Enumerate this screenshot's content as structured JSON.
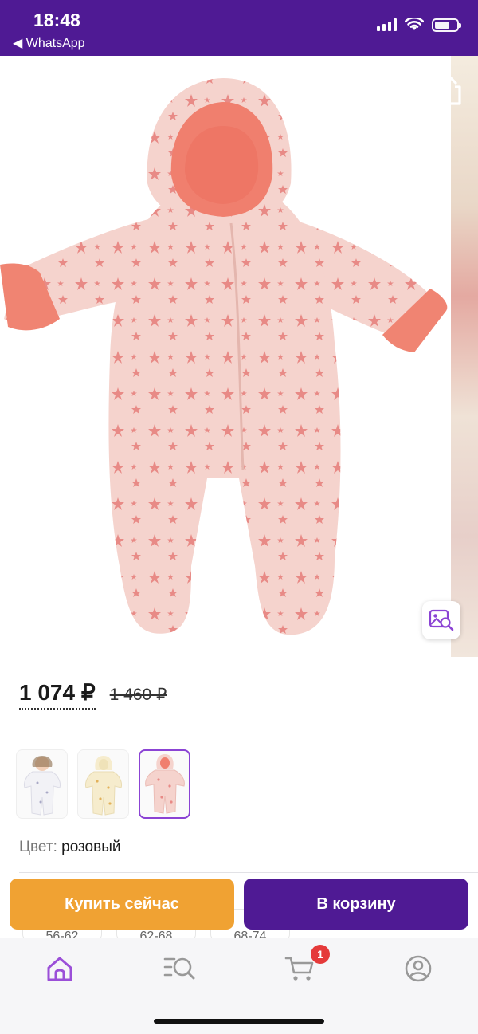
{
  "status_bar": {
    "time": "18:48",
    "back_app": "◀ WhatsApp"
  },
  "gallery": {
    "back_icon": "chevron-left-icon",
    "favorite_icon": "heart-outline-icon",
    "share_icon": "share-icon",
    "visual_search_icon": "image-search-icon",
    "product_image": "pink-star-print-baby-snowsuit"
  },
  "product": {
    "price": "1 074 ₽",
    "old_price": "1 460 ₽",
    "variants": [
      {
        "image": "white-snowsuit-with-baby",
        "selected": false
      },
      {
        "image": "cream-star-snowsuit",
        "selected": false
      },
      {
        "image": "pink-star-snowsuit",
        "selected": true
      }
    ],
    "color_label": "Цвет:",
    "color_value": "розовый",
    "sizes": [
      {
        "label": "56-62",
        "top": ""
      },
      {
        "label": "62-68",
        "top": ""
      },
      {
        "label": "68-74",
        "top": "7"
      }
    ]
  },
  "actions": {
    "buy_now": "Купить сейчас",
    "add_to_cart": "В корзину"
  },
  "tabbar": {
    "items": [
      {
        "name": "home",
        "icon": "home-icon",
        "active": true
      },
      {
        "name": "catalog",
        "icon": "catalog-search-icon",
        "active": false
      },
      {
        "name": "cart",
        "icon": "cart-icon",
        "active": false
      },
      {
        "name": "profile",
        "icon": "profile-icon",
        "active": false
      }
    ],
    "cart_badge": "1"
  },
  "colors": {
    "brand_purple": "#4f1a94",
    "buy_orange": "#f0a233",
    "active_tab": "#9b4fd8",
    "badge_red": "#e53a3a"
  }
}
